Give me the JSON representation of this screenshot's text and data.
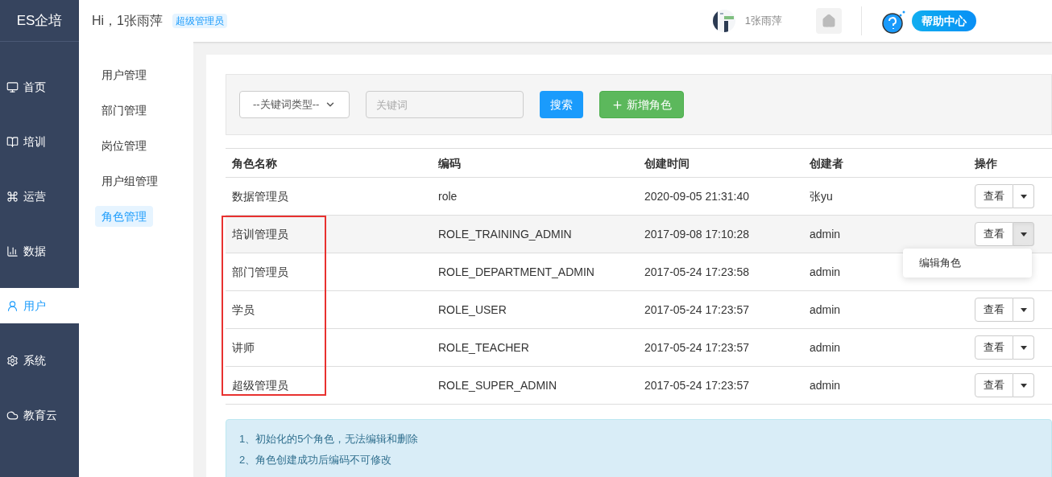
{
  "brand": "ES企培",
  "header": {
    "greeting": "Hi，1张雨萍",
    "role_badge": "超级管理员",
    "user_name": "1张雨萍",
    "help_label": "帮助中心"
  },
  "nav": [
    {
      "label": "首页",
      "selected": false
    },
    {
      "label": "培训",
      "selected": false
    },
    {
      "label": "运营",
      "selected": false
    },
    {
      "label": "数据",
      "selected": false
    },
    {
      "label": "用户",
      "selected": true
    },
    {
      "label": "系统",
      "selected": false
    },
    {
      "label": "教育云",
      "selected": false
    }
  ],
  "subnav": [
    {
      "label": "用户管理",
      "selected": false
    },
    {
      "label": "部门管理",
      "selected": false
    },
    {
      "label": "岗位管理",
      "selected": false
    },
    {
      "label": "用户组管理",
      "selected": false
    },
    {
      "label": "角色管理",
      "selected": true
    }
  ],
  "filter": {
    "select_value": "--关键词类型--",
    "placeholder": "关键词",
    "search_button": "搜索",
    "add_button": "新增角色"
  },
  "table": {
    "columns": [
      "角色名称",
      "编码",
      "创建时间",
      "创建者",
      "操作"
    ],
    "rows": [
      {
        "name": "数据管理员",
        "code": "role",
        "created": "2020-09-05 21:31:40",
        "creator": "张yu",
        "action": "查看",
        "menu_open": false
      },
      {
        "name": "培训管理员",
        "code": "ROLE_TRAINING_ADMIN",
        "created": "2017-09-08 17:10:28",
        "creator": "admin",
        "action": "查看",
        "menu_open": true,
        "menu_items": [
          "编辑角色"
        ]
      },
      {
        "name": "部门管理员",
        "code": "ROLE_DEPARTMENT_ADMIN",
        "created": "2017-05-24 17:23:58",
        "creator": "admin",
        "menu_open": false
      },
      {
        "name": "学员",
        "code": "ROLE_USER",
        "created": "2017-05-24 17:23:57",
        "creator": "admin",
        "action": "查看",
        "menu_open": false
      },
      {
        "name": "讲师",
        "code": "ROLE_TEACHER",
        "created": "2017-05-24 17:23:57",
        "creator": "admin",
        "action": "查看",
        "menu_open": false
      },
      {
        "name": "超级管理员",
        "code": "ROLE_SUPER_ADMIN",
        "created": "2017-05-24 17:23:57",
        "creator": "admin",
        "action": "查看",
        "menu_open": false
      }
    ]
  },
  "notes": [
    "1、初始化的5个角色，无法编辑和删除",
    "2、角色创建成功后编码不可修改"
  ]
}
